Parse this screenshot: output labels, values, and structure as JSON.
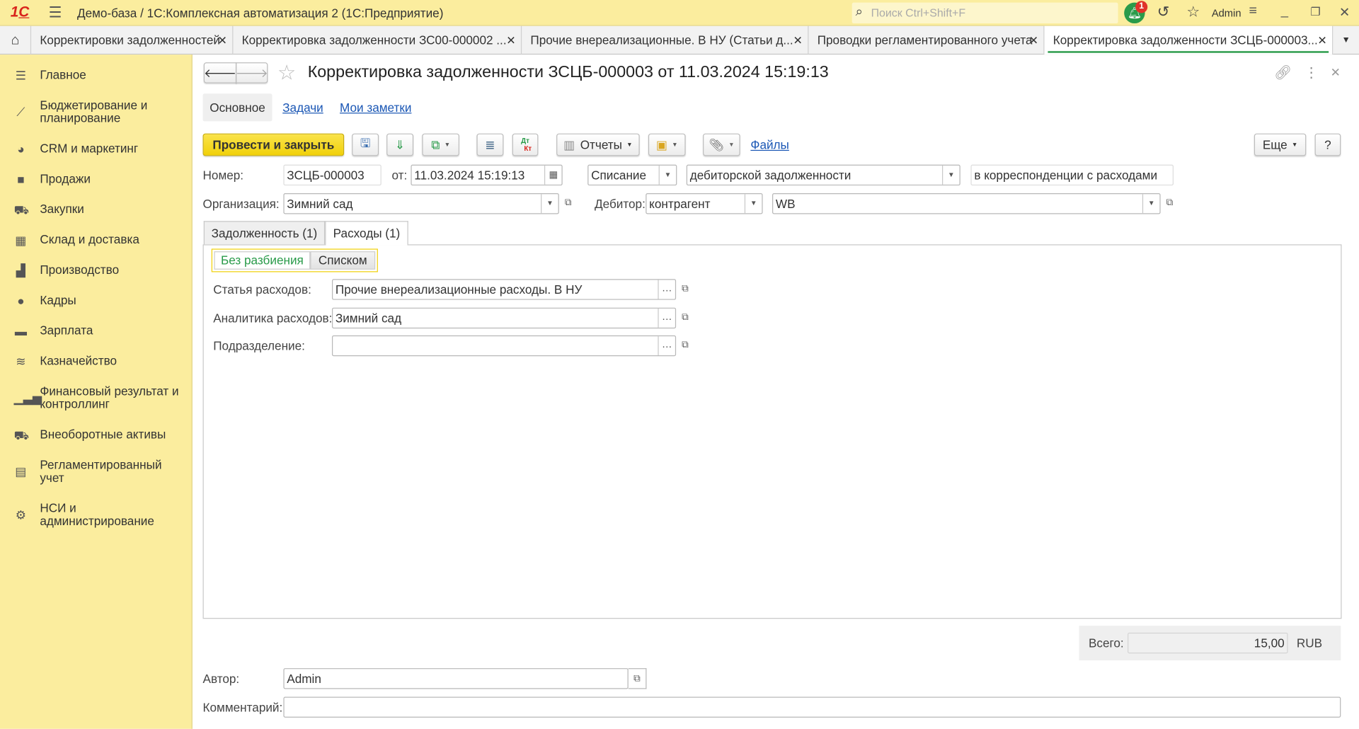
{
  "app": {
    "title": "Демо-база / 1С:Комплексная автоматизация 2  (1С:Предприятие)",
    "search_placeholder": "Поиск Ctrl+Shift+F",
    "notifications_count": "1",
    "user": "Admin",
    "logo": "1С"
  },
  "window_tabs": [
    {
      "label": "Корректировки задолженностей"
    },
    {
      "label": "Корректировка задолженности ЗС00-000002 ..."
    },
    {
      "label": "Прочие внереализационные. В НУ (Статьи д..."
    },
    {
      "label": "Проводки регламентированного учета"
    },
    {
      "label": "Корректировка задолженности ЗСЦБ-000003..."
    }
  ],
  "sidebar": {
    "items": [
      {
        "label": "Главное",
        "icon": "menu-icon"
      },
      {
        "label": "Бюджетирование и планирование",
        "icon": "chart-icon"
      },
      {
        "label": "CRM и маркетинг",
        "icon": "pie-icon"
      },
      {
        "label": "Продажи",
        "icon": "bag-icon"
      },
      {
        "label": "Закупки",
        "icon": "cart-icon"
      },
      {
        "label": "Склад и доставка",
        "icon": "warehouse-icon"
      },
      {
        "label": "Производство",
        "icon": "factory-icon"
      },
      {
        "label": "Кадры",
        "icon": "person-icon"
      },
      {
        "label": "Зарплата",
        "icon": "wallet-icon"
      },
      {
        "label": "Казначейство",
        "icon": "coins-icon"
      },
      {
        "label": "Финансовый результат и контроллинг",
        "icon": "bar-chart-icon"
      },
      {
        "label": "Внеоборотные активы",
        "icon": "truck-icon"
      },
      {
        "label": "Регламентированный учет",
        "icon": "report-icon"
      },
      {
        "label": "НСИ и администрирование",
        "icon": "gear-icon"
      }
    ]
  },
  "form": {
    "title": "Корректировка задолженности ЗСЦБ-000003 от 11.03.2024 15:19:13",
    "nav_tabs": [
      "Основное",
      "Задачи",
      "Мои заметки"
    ],
    "toolbar": {
      "post_close": "Провести и закрыть",
      "reports": "Отчеты",
      "files": "Файлы",
      "more": "Еще",
      "help": "?",
      "dtkt_top": "Дт",
      "dtkt_bottom": "Кт"
    },
    "number_label": "Номер:",
    "number": "ЗСЦБ-000003",
    "date_label": "от:",
    "date": "11.03.2024 15:19:13",
    "operation": "Списание",
    "operation_object": "дебиторской задолженности",
    "operation_corr": "в корреспонденции с расходами",
    "org_label": "Организация:",
    "org": "Зимний сад",
    "debtor_label": "Дебитор:",
    "debtor_type": "контрагент",
    "debtor": "WB",
    "tabs": [
      "Задолженность (1)",
      "Расходы (1)"
    ],
    "split_toggle": [
      "Без разбиения",
      "Списком"
    ],
    "expense_item_label": "Статья расходов:",
    "expense_item": "Прочие внереализационные расходы. В НУ",
    "expense_analytics_label": "Аналитика расходов:",
    "expense_analytics": "Зимний сад",
    "department_label": "Подразделение:",
    "department": "",
    "total_label": "Всего:",
    "total": "15,00",
    "currency": "RUB",
    "author_label": "Автор:",
    "author": "Admin",
    "comment_label": "Комментарий:",
    "comment": ""
  },
  "colors": {
    "accent_yellow": "#fbed9e",
    "primary_button": "#f1d10a",
    "active_green": "#2a9b4a",
    "link": "#1b57b5"
  }
}
